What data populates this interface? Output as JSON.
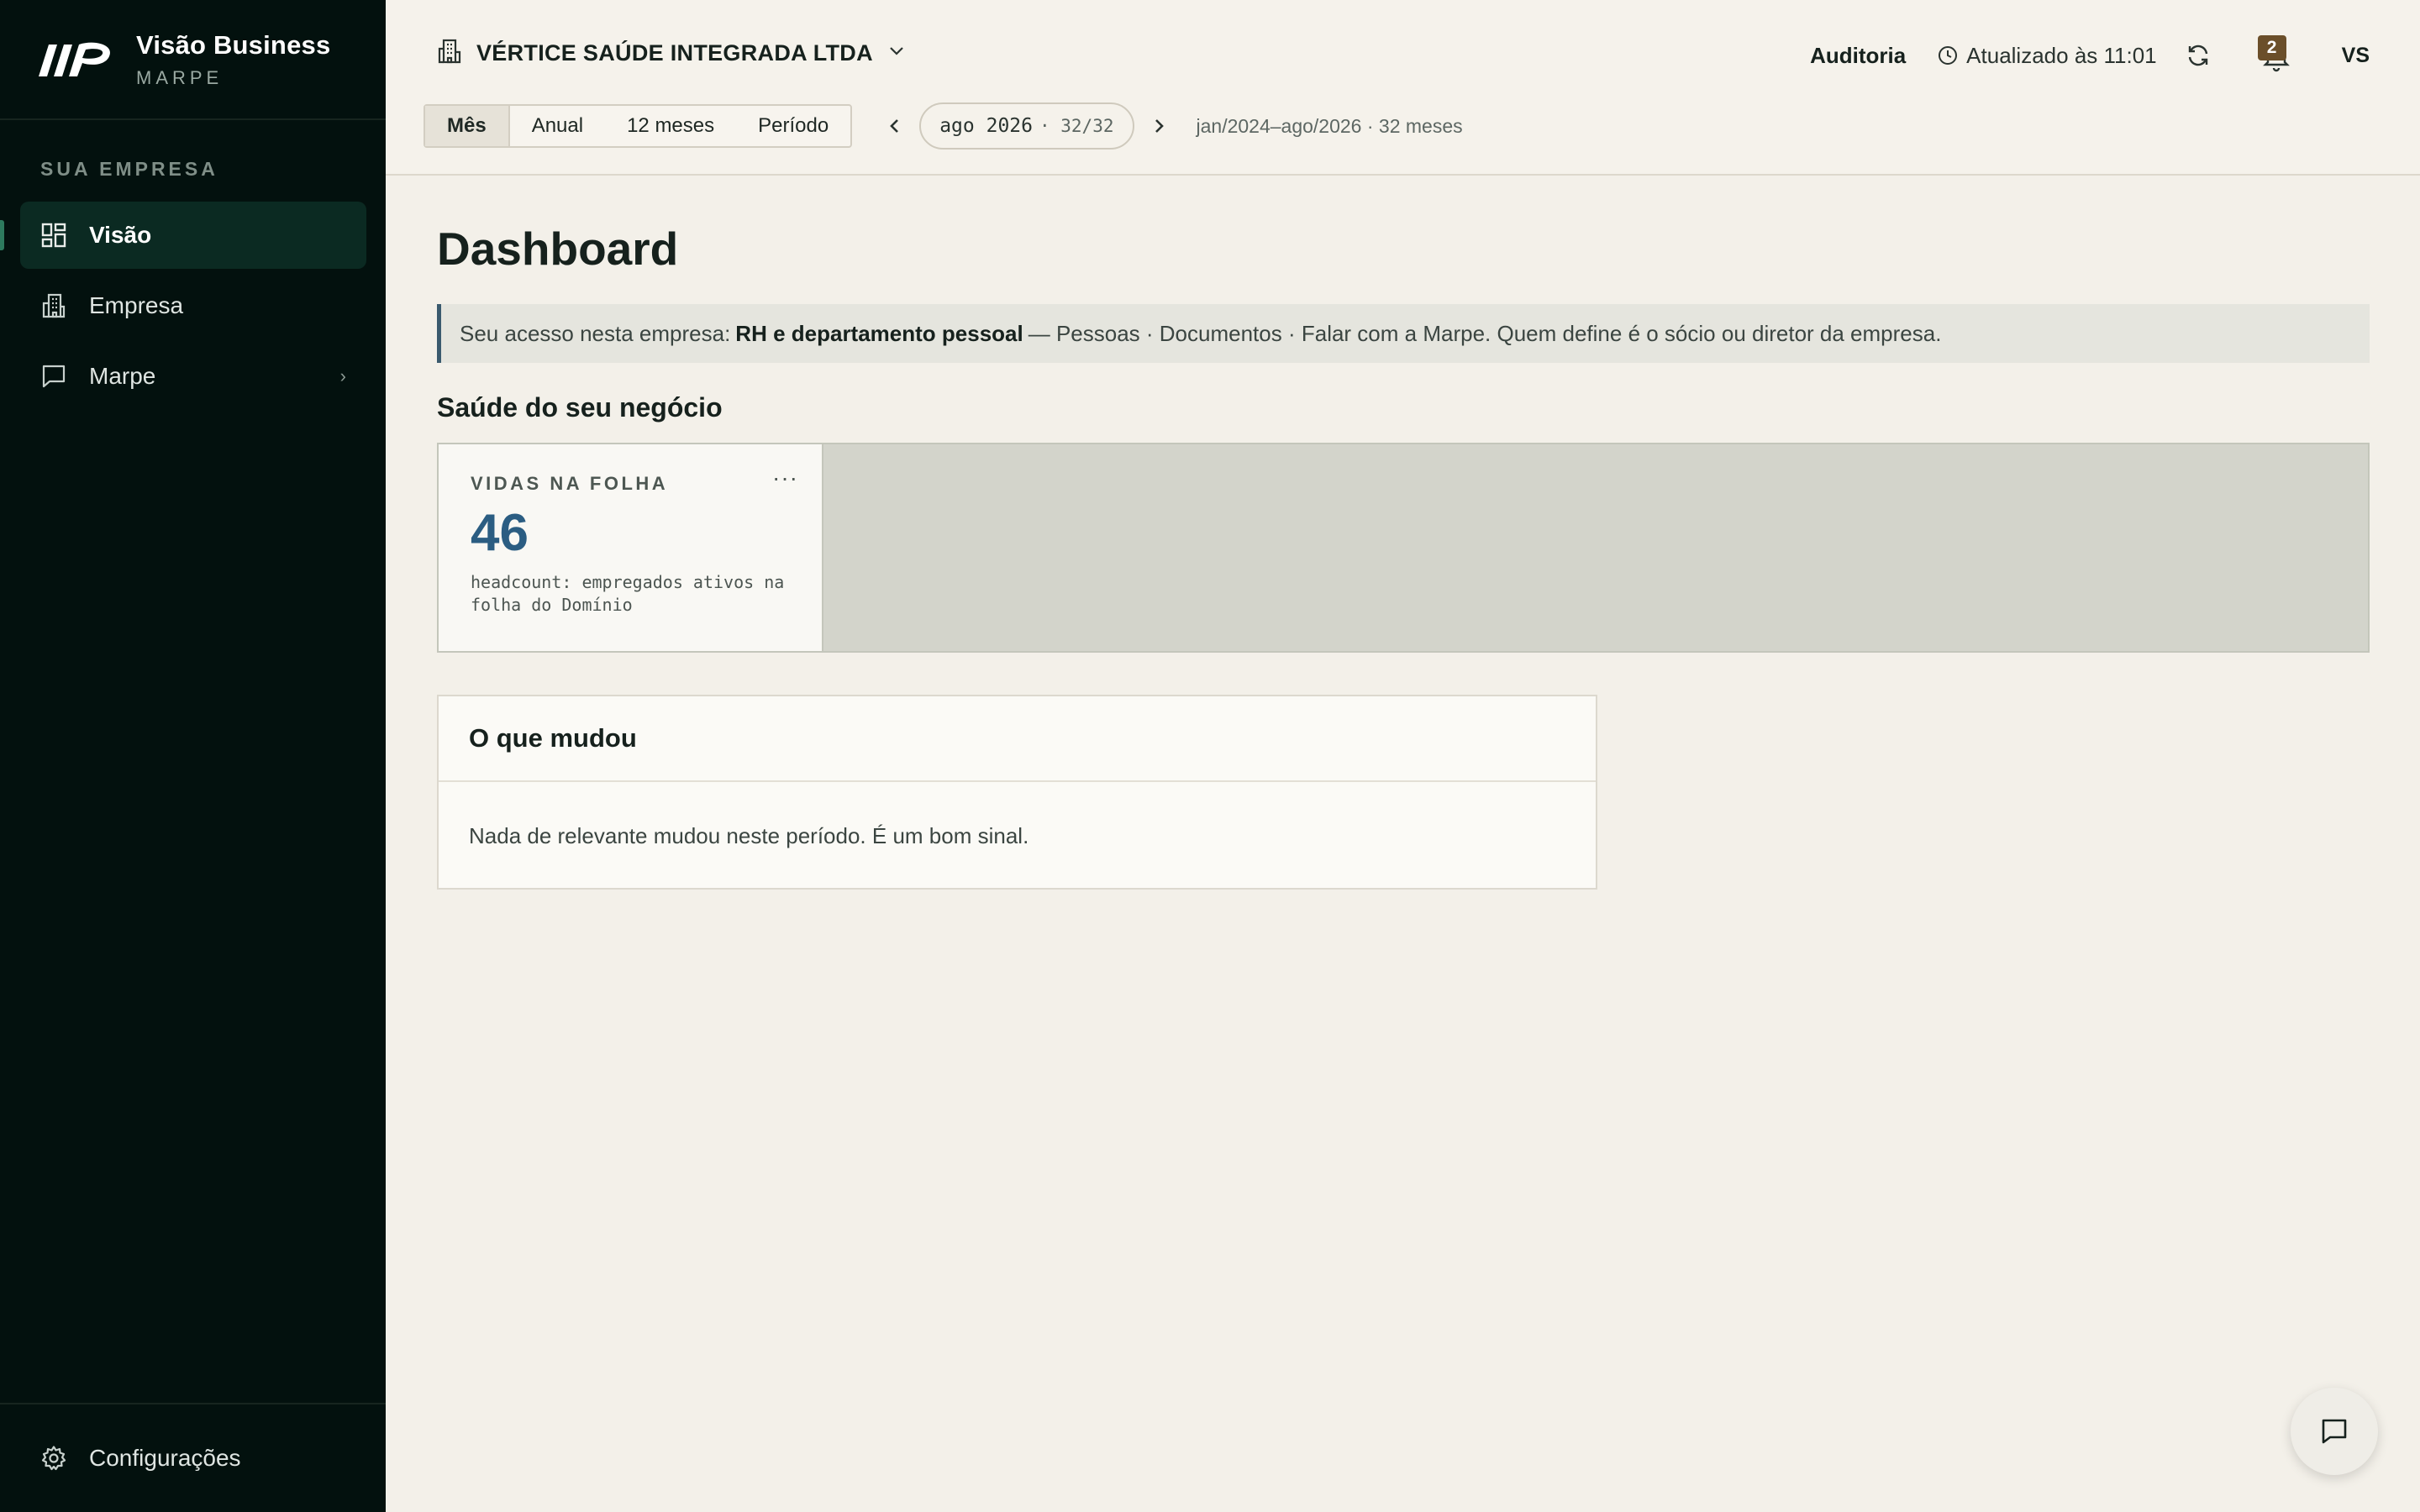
{
  "app": {
    "brand_title": "Visão Business",
    "brand_subtitle": "MARPE"
  },
  "sidebar": {
    "section_title": "SUA EMPRESA",
    "items": [
      {
        "label": "Visão",
        "icon": "dashboard-icon",
        "active": true
      },
      {
        "label": "Empresa",
        "icon": "building-icon",
        "active": false
      },
      {
        "label": "Marpe",
        "icon": "chat-icon",
        "active": false,
        "has_children": true
      }
    ],
    "footer_label": "Configurações"
  },
  "header": {
    "company_name": "VÉRTICE SAÚDE INTEGRADA LTDA",
    "audit_label": "Auditoria",
    "updated_label": "Atualizado às 11:01",
    "notifications_count": "2",
    "avatar_initials": "VS",
    "period_tabs": [
      "Mês",
      "Anual",
      "12 meses",
      "Período"
    ],
    "active_tab": "Mês",
    "period_value": "ago 2026",
    "period_position": "· 32/32",
    "period_range": "jan/2024–ago/2026 · 32 meses"
  },
  "main": {
    "page_title": "Dashboard",
    "access_prefix": "Seu acesso nesta empresa:",
    "access_role": "RH e departamento pessoal",
    "access_suffix": "— Pessoas · Documentos · Falar com a Marpe. Quem define é o sócio ou diretor da empresa.",
    "health_title": "Saúde do seu negócio",
    "kpi": {
      "label": "VIDAS NA FOLHA",
      "value": "46",
      "description": "headcount: empregados ativos na folha do Domínio",
      "menu": "···"
    },
    "changes_title": "O que mudou",
    "changes_body": "Nada de relevante mudou neste período. É um bom sinal."
  },
  "colors": {
    "sidebar_bg": "#03110e",
    "accent": "#2b5d82",
    "badge": "#6b4f2a",
    "background": "#f3f0e9"
  }
}
